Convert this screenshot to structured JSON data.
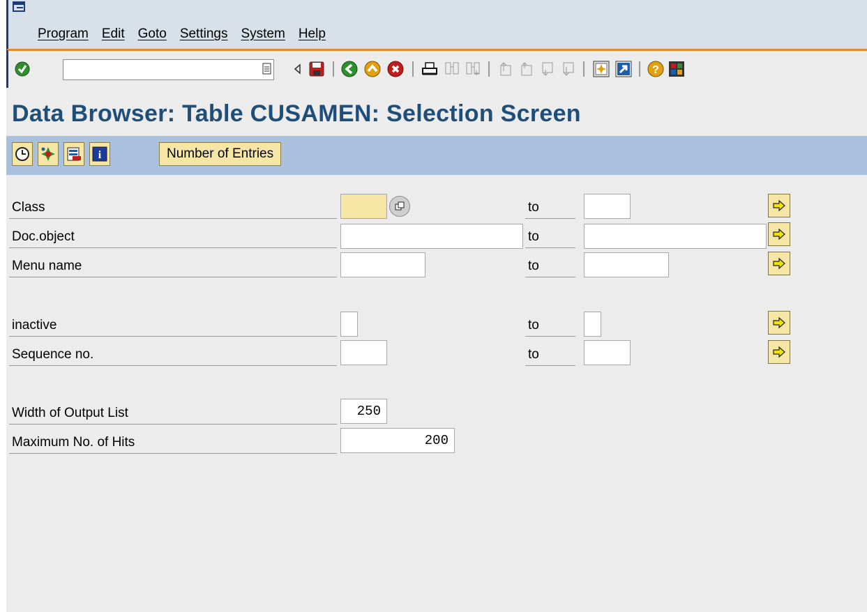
{
  "menu": {
    "items": [
      "Program",
      "Edit",
      "Goto",
      "Settings",
      "System",
      "Help"
    ]
  },
  "toolbar": {
    "command_field_value": "",
    "icons": [
      "enter-icon",
      "command-field-history-icon",
      "collapse-icon",
      "save-icon",
      "back-icon",
      "exit-icon",
      "cancel-icon",
      "print-icon",
      "find-icon",
      "find-next-icon",
      "first-page-icon",
      "previous-page-icon",
      "next-page-icon",
      "last-page-icon",
      "create-session-icon",
      "shortcut-icon",
      "help-icon",
      "layout-menu-icon"
    ]
  },
  "screen": {
    "title": "Data Browser: Table CUSAMEN: Selection Screen"
  },
  "app_toolbar": {
    "icons": [
      "execute-icon",
      "selection-options-icon",
      "field-selection-icon",
      "information-icon"
    ],
    "number_of_entries_label": "Number of Entries"
  },
  "form": {
    "to_label": "to",
    "rows": [
      {
        "label": "Class",
        "from": "",
        "to": ""
      },
      {
        "label": "Doc.object",
        "from": "",
        "to": ""
      },
      {
        "label": "Menu name",
        "from": "",
        "to": ""
      },
      {
        "label": "inactive",
        "from": "",
        "to": ""
      },
      {
        "label": "Sequence no.",
        "from": "",
        "to": ""
      }
    ],
    "width_of_output_list": {
      "label": "Width of Output List",
      "value": "250"
    },
    "maximum_no_of_hits": {
      "label": "Maximum No. of Hits",
      "value": "200"
    }
  },
  "colors": {
    "menu_bar_bg": "#d8e0ea",
    "toolbar_accent": "#e88a26",
    "title_color": "#1f4e79",
    "app_toolbar_bg": "#a9c1dc",
    "button_bg": "#f6e6a6",
    "screen_bg": "#ececec"
  }
}
